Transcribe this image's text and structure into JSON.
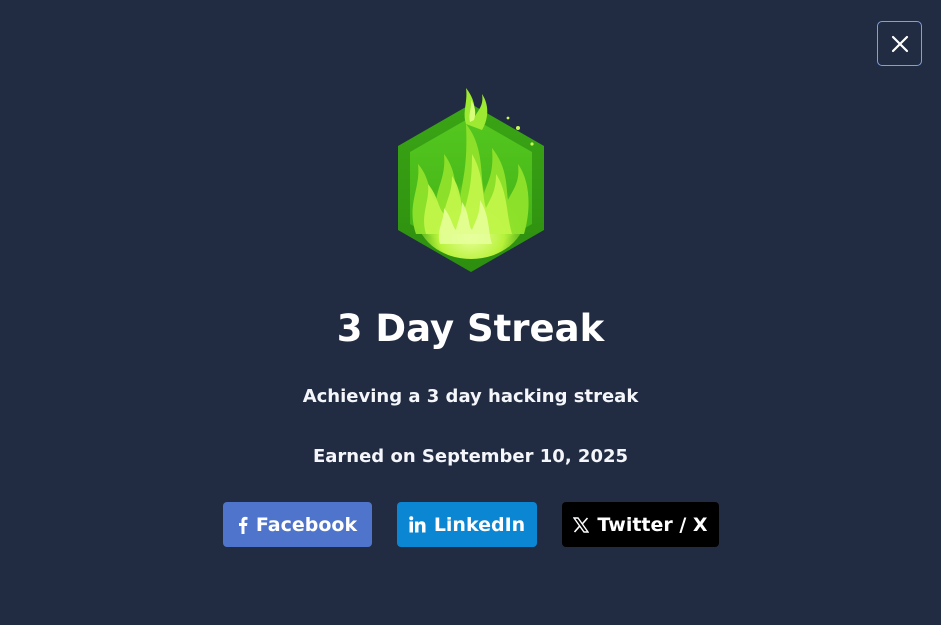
{
  "dialog": {
    "close_icon": "close-icon",
    "badge_icon": "flame-hexagon-badge",
    "title": "3 Day Streak",
    "description": "Achieving a 3 day hacking streak",
    "earned_text": "Earned on September 10, 2025"
  },
  "share": {
    "facebook": {
      "label": "Facebook",
      "icon": "facebook-icon",
      "color": "#4e75cb"
    },
    "linkedin": {
      "label": "LinkedIn",
      "icon": "linkedin-icon",
      "color": "#0b86d2"
    },
    "twitter": {
      "label": "Twitter / X",
      "icon": "x-logo-icon",
      "color": "#000000"
    }
  },
  "colors": {
    "background": "#212c42",
    "close_border": "#7d9fe3",
    "badge_green_dark": "#2f9a12",
    "badge_green_light": "#b6f53a"
  }
}
